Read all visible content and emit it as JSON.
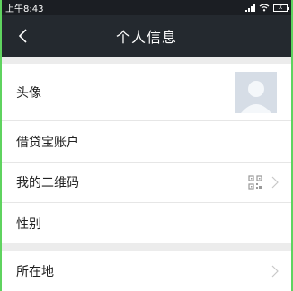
{
  "status_bar": {
    "time": "上午8:43",
    "battery_label": "X",
    "icons": [
      "signal-icon",
      "wifi-icon",
      "battery-icon"
    ]
  },
  "nav": {
    "title": "个人信息",
    "back_icon": "chevron-left-icon"
  },
  "rows": [
    {
      "label": "头像",
      "accessory": "avatar-image"
    },
    {
      "label": "借贷宝账户"
    },
    {
      "label": "我的二维码",
      "accessory": "qr-code-icon",
      "chevron": true
    },
    {
      "label": "性别"
    },
    {
      "label": "所在地",
      "chevron": true
    }
  ],
  "colors": {
    "nav_bg": "#24292f",
    "status_bg": "#1b1e23",
    "page_bg": "#f0f0f0",
    "row_bg": "#ffffff",
    "avatar_bg": "#d6dde6"
  }
}
